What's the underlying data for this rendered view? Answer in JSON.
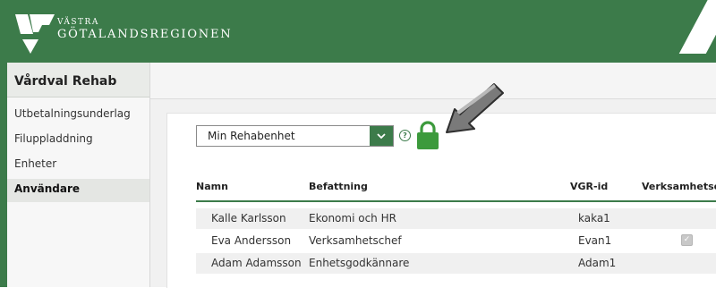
{
  "brand": {
    "line1": "VÄSTRA",
    "line2": "GÖTALANDSREGIONEN",
    "color": "#3c7b4a"
  },
  "sidebar": {
    "title": "Vårdval Rehab",
    "items": [
      {
        "label": "Utbetalningsunderlag",
        "active": false
      },
      {
        "label": "Filuppladdning",
        "active": false
      },
      {
        "label": "Enheter",
        "active": false
      },
      {
        "label": "Användare",
        "active": true
      }
    ]
  },
  "unit_select": {
    "selected": "Min Rehabenhet"
  },
  "icons": {
    "help": "?",
    "lock": "lock-icon",
    "arrow": "arrow-pointer-icon",
    "chevron": "chevron-down-icon"
  },
  "table": {
    "columns": [
      "Namn",
      "Befattning",
      "VGR-id",
      "Verksamhetsch"
    ],
    "rows": [
      {
        "name": "Kalle Karlsson",
        "title": "Ekonomi och HR",
        "vgr_id": "kaka1",
        "is_manager": false
      },
      {
        "name": "Eva Andersson",
        "title": "Verksamhetschef",
        "vgr_id": "Evan1",
        "is_manager": true
      },
      {
        "name": "Adam Adamsson",
        "title": "Enhetsgodkännare",
        "vgr_id": "Adam1",
        "is_manager": false
      }
    ]
  }
}
